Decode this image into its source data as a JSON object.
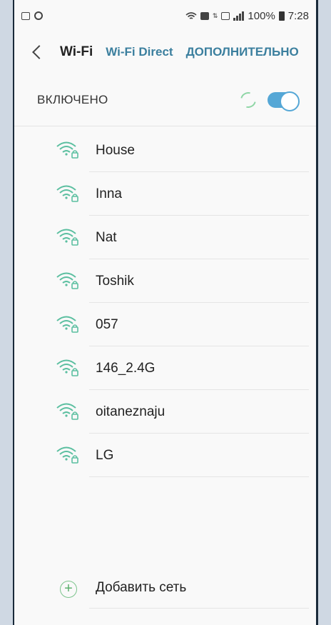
{
  "status_bar": {
    "battery_percent": "100%",
    "time": "7:28"
  },
  "header": {
    "title": "Wi-Fi",
    "wifi_direct_label": "Wi-Fi Direct",
    "advanced_label": "ДОПОЛНИТЕЛЬНО"
  },
  "wifi_toggle": {
    "label": "ВКЛЮЧЕНО",
    "on": true
  },
  "networks": [
    {
      "name": "House"
    },
    {
      "name": "Inna"
    },
    {
      "name": "Nat"
    },
    {
      "name": "Toshik"
    },
    {
      "name": "057"
    },
    {
      "name": "146_2.4G"
    },
    {
      "name": "oitaneznaju"
    },
    {
      "name": "LG"
    }
  ],
  "add_network": {
    "label": "Добавить сеть"
  },
  "colors": {
    "accent": "#3b7f9e",
    "switch": "#55a7d6",
    "add_icon": "#5bb06d",
    "wifi_icon": "#5bbfa0"
  }
}
